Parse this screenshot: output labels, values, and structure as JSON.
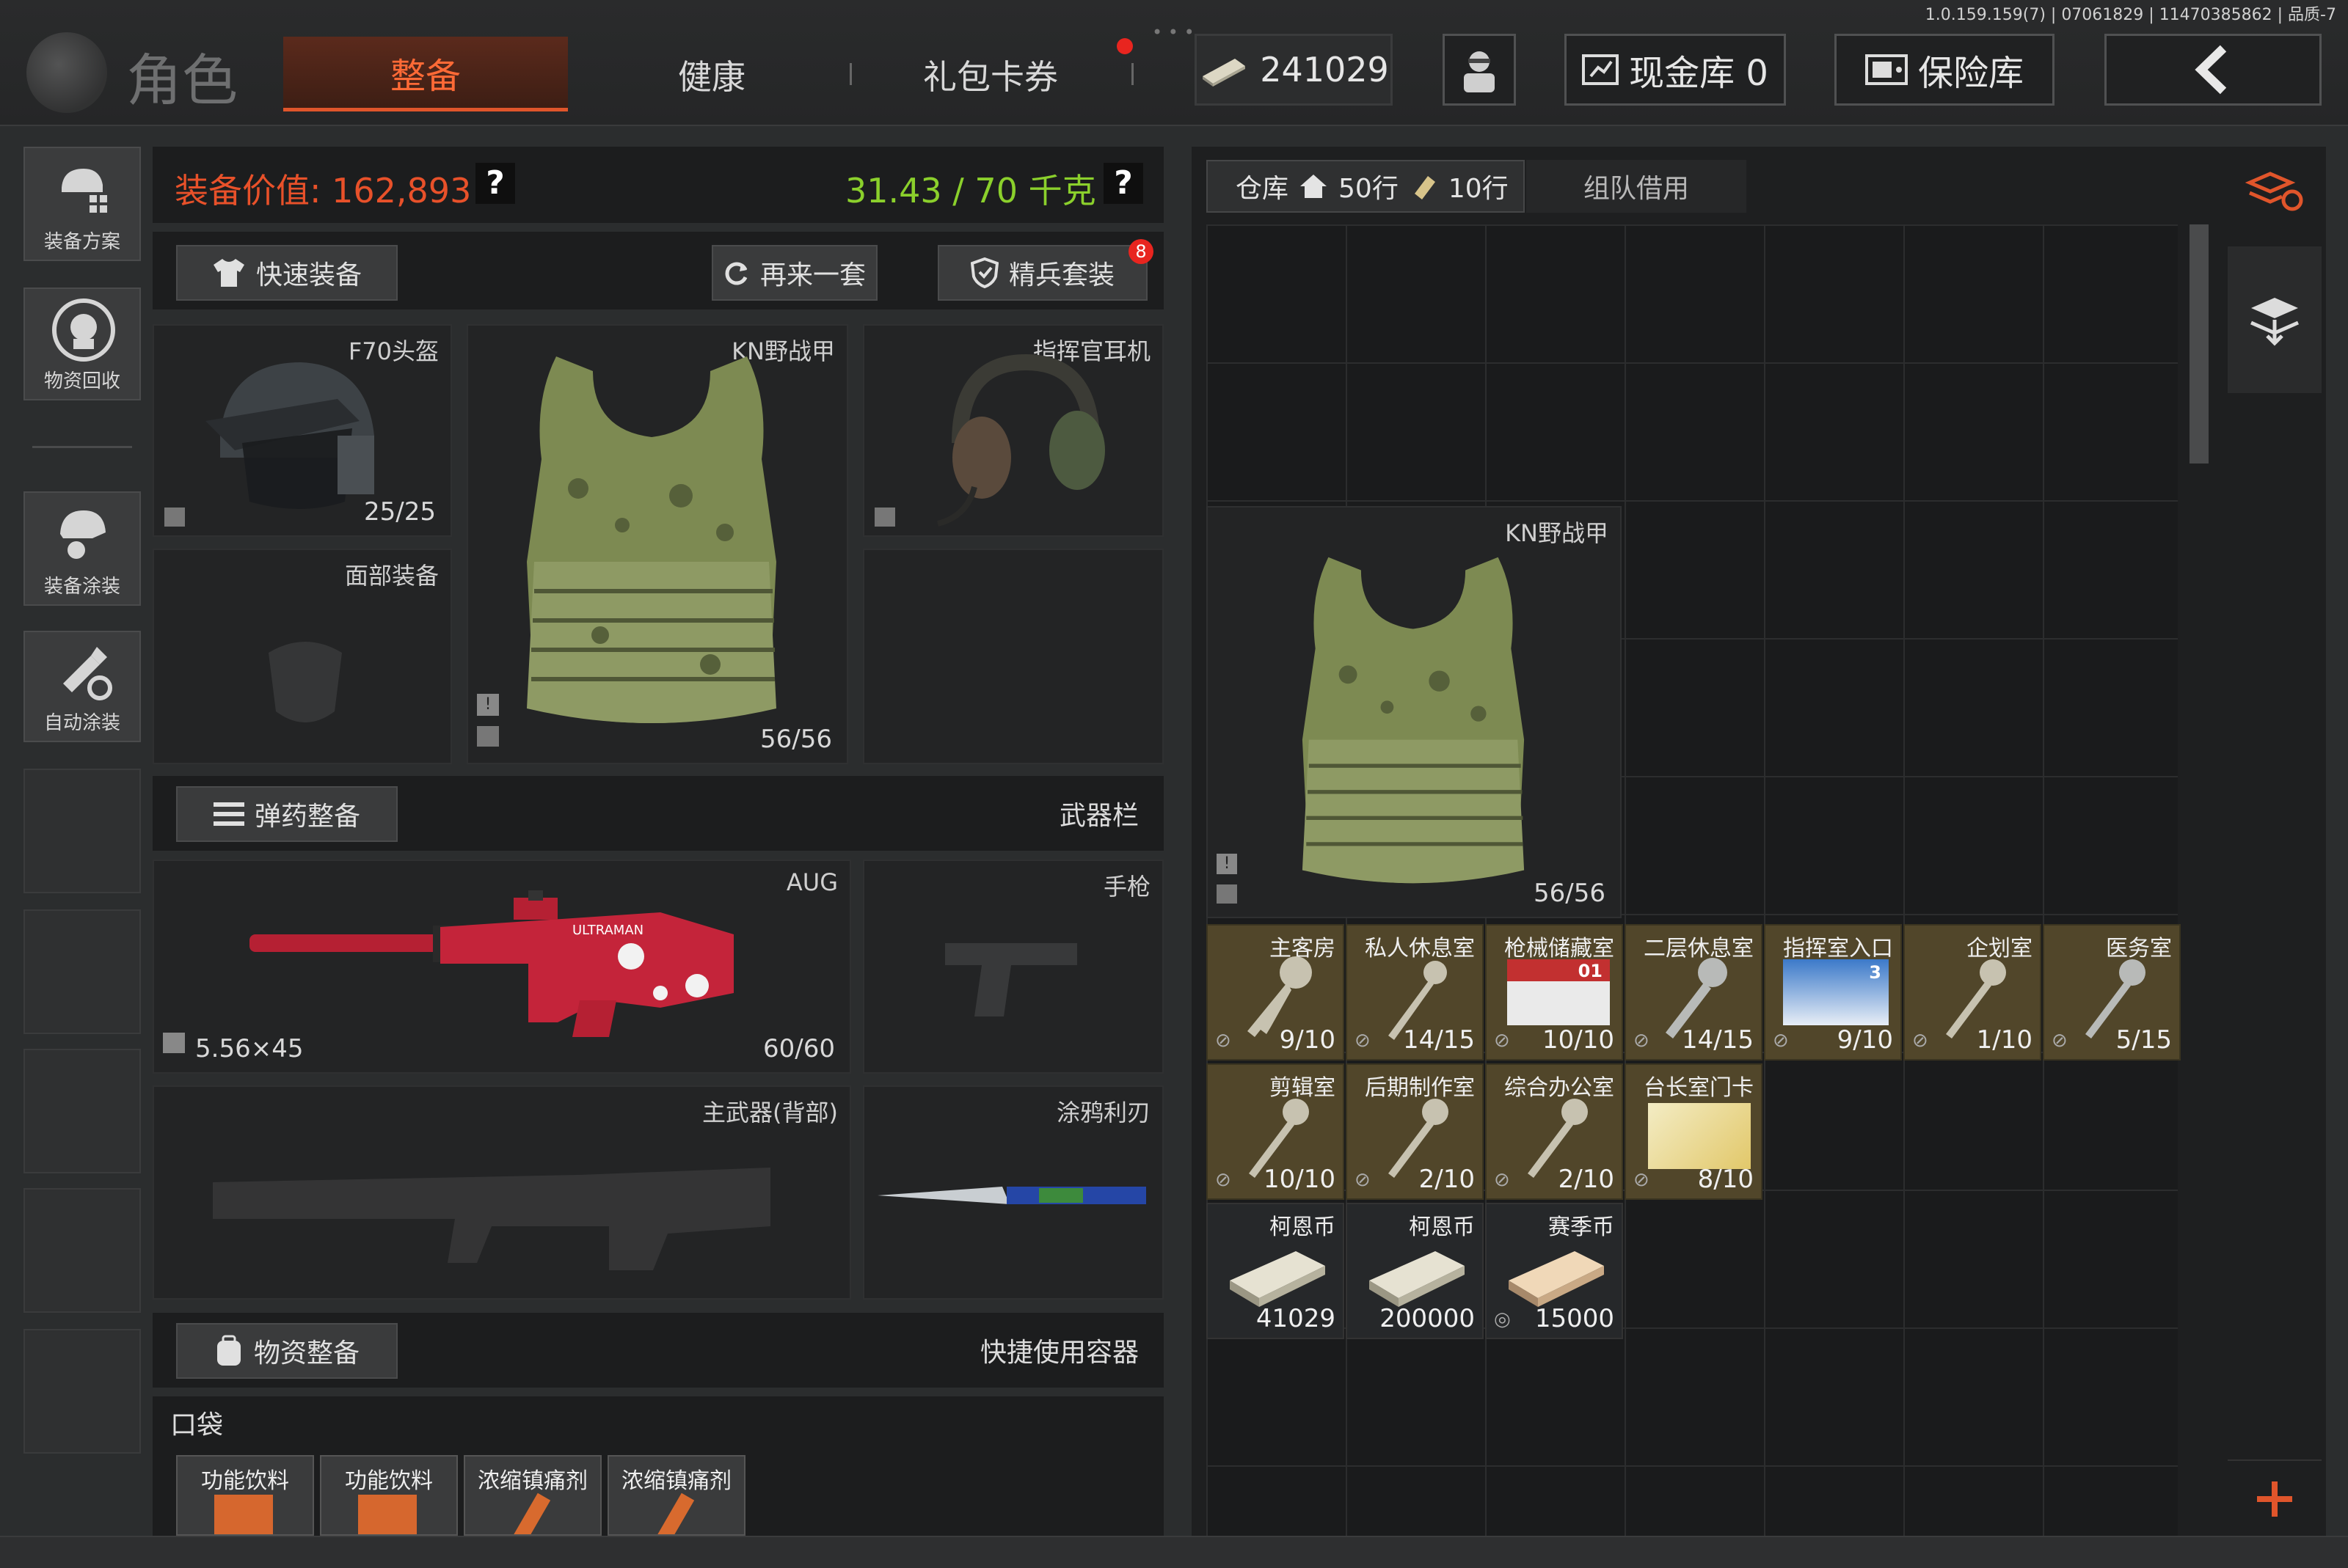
{
  "version": "1.0.159.159(7) | 07061829 | 11470385862 | 品质-7",
  "top": {
    "title": "角色",
    "tabs": [
      "整备",
      "健康",
      "礼包卡券"
    ],
    "currency": "241029",
    "cash_vault": "现金库 0",
    "safe_vault": "保险库"
  },
  "sidebar": [
    {
      "label": "装备方案",
      "icon": "gear-plan-icon"
    },
    {
      "label": "物资回收",
      "icon": "recycle-icon"
    },
    {
      "label": "装备涂装",
      "icon": "paint-helmet-icon"
    },
    {
      "label": "自动涂装",
      "icon": "spray-icon"
    }
  ],
  "loadout": {
    "value_label": "装备价值: 162,893",
    "weight_label": "31.43 / 70 千克",
    "help": "?",
    "quick_equip": "快速装备",
    "another_set": "再来一套",
    "elite_set": "精兵套装",
    "elite_badge": "8",
    "helmet": {
      "name": "F70头盔",
      "count": "25/25"
    },
    "armor": {
      "name": "KN野战甲",
      "count": "56/56"
    },
    "headset": {
      "name": "指挥官耳机"
    },
    "face": {
      "name": "面部装备"
    }
  },
  "weapons": {
    "ammo_btn": "弹药整备",
    "header_right": "武器栏",
    "primary": {
      "name": "AUG",
      "ammo": "5.56×45",
      "count": "60/60",
      "skin_text": "ULTRAMAN"
    },
    "pistol": {
      "name": "手枪"
    },
    "back": {
      "name": "主武器(背部)"
    },
    "melee": {
      "name": "涂鸦利刃"
    }
  },
  "supplies": {
    "btn": "物资整备",
    "header_right": "快捷使用容器",
    "pocket_label": "口袋",
    "pockets": [
      "功能饮料",
      "功能饮料",
      "浓缩镇痛剂",
      "浓缩镇痛剂"
    ]
  },
  "warehouse": {
    "tab_label": "仓库",
    "rows_home": "50行",
    "rows_ticket": "10行",
    "team_borrow": "组队借用",
    "armor": {
      "name": "KN野战甲",
      "count": "56/56"
    },
    "keys": [
      {
        "name": "主客房",
        "count": "9/10"
      },
      {
        "name": "私人休息室",
        "count": "14/15"
      },
      {
        "name": "枪械储藏室",
        "count": "10/10",
        "card": "01"
      },
      {
        "name": "二层休息室",
        "count": "14/15"
      },
      {
        "name": "指挥室入口",
        "count": "9/10",
        "card": "3"
      },
      {
        "name": "企划室",
        "count": "1/10"
      },
      {
        "name": "医务室",
        "count": "5/15"
      },
      {
        "name": "剪辑室",
        "count": "10/10"
      },
      {
        "name": "后期制作室",
        "count": "2/10"
      },
      {
        "name": "综合办公室",
        "count": "2/10"
      },
      {
        "name": "台长室门卡",
        "count": "8/10"
      }
    ],
    "money": [
      {
        "name": "柯恩币",
        "count": "41029"
      },
      {
        "name": "柯恩币",
        "count": "200000"
      },
      {
        "name": "赛季币",
        "count": "15000"
      }
    ]
  },
  "colors": {
    "accent": "#e0552b",
    "value_red": "#e8512a",
    "weight_green": "#8bd02c",
    "key_slot": "#51462a",
    "add_plus": "#e0552b"
  }
}
